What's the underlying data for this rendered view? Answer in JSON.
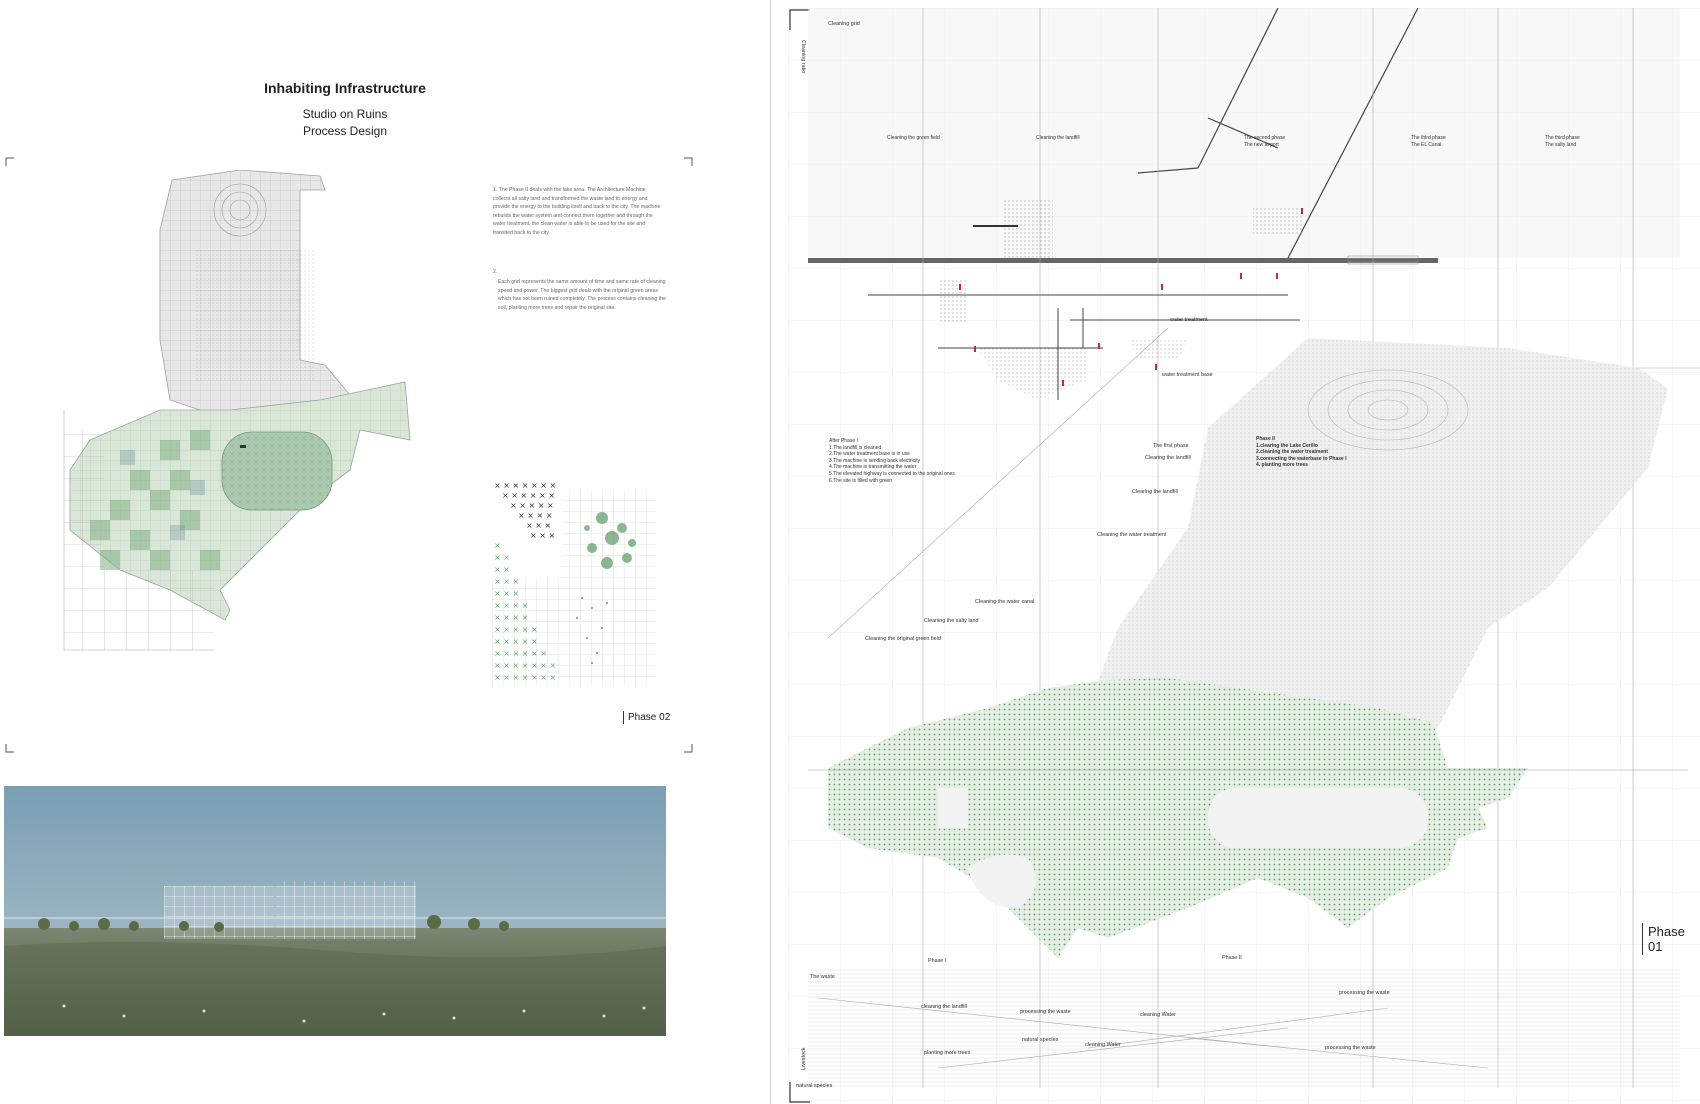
{
  "left_panel": {
    "title": "Inhabiting Infrastructure",
    "subtitle_1": "Studio on Ruins",
    "subtitle_2": "Process Design",
    "description_1": "1.  The Phase II deals with the lake area. The Architecture Machine collects all salty land and transformed the waste land to energy and provide the energy to the building itself and back to the city. The machine rebuilds the water system and connect them together and through the water treatment, the clean water is able to be used for the site and transited back to the city.",
    "description_2": "2.",
    "description_3": "Each grid represents the same amount of time and same rate of cleaning speed and power. The biggest grid deals with the original green areas which has not been ruined completely. The process contains cleaning the soil, planting more trees and repair the original site.",
    "phase_tag": "Phase 02"
  },
  "right_panel": {
    "corner_label": "Cleaning grid",
    "side_label": "Cleaning ratio",
    "top_labels": [
      "Cleaning the green field",
      "Cleaning the landfill",
      "The second phase\nThe new airport",
      "The third phase\nThe EL Canal",
      "The third phase\nThe salty land"
    ],
    "water_treatment": "water treatment",
    "water_treatment_base": "water treatment base",
    "after_phase_note": "After Phase I\n1.The landfill is cleaned\n2.The water treatment base is in use\n3.The machine is sending back electricity\n4.The machine is transmitting the water\n5.The elevated highway is connected to the original ones\n6.The site is filled with green",
    "phase2_note": "Phase II\n1.clearing the Lake Cerillo\n2.cleaning the water treatment\n3.connecting the waterbase to Phase I\n4. planting more trees",
    "process_labels": [
      "The first phase",
      "Clearing the landfill",
      "Clearing the landfill",
      "Cleaning the water treatment",
      "Cleaning the water canal",
      "Cleaning the salty land",
      "Cleaning the original green field"
    ],
    "phase_tag": "Phase 01",
    "phase_i": "Phase I",
    "phase_ii": "Phase II",
    "bottom_labels": {
      "the_waste": "The waste",
      "cleaning_landfill": "cleaning the landfill",
      "processing_waste_1": "processing the waste",
      "cleaning_water_1": "cleaning Water",
      "processing_waste_2": "processing the waste",
      "natural_species_1": "natural species",
      "cleaning_water_2": "cleaning Water",
      "planting_more_trees": "planting more trees",
      "processing_waste_3": "processing the waste",
      "natural_species_2": "natural species",
      "left_vertical": "Livestock"
    }
  },
  "colors": {
    "green_fill": "#7fae84",
    "green_dark": "#3f7a48",
    "grid_grey": "#b9b9b9",
    "accent_red": "#c0302a",
    "sky": "#8aa9bb",
    "grass": "#5d6a4e"
  }
}
